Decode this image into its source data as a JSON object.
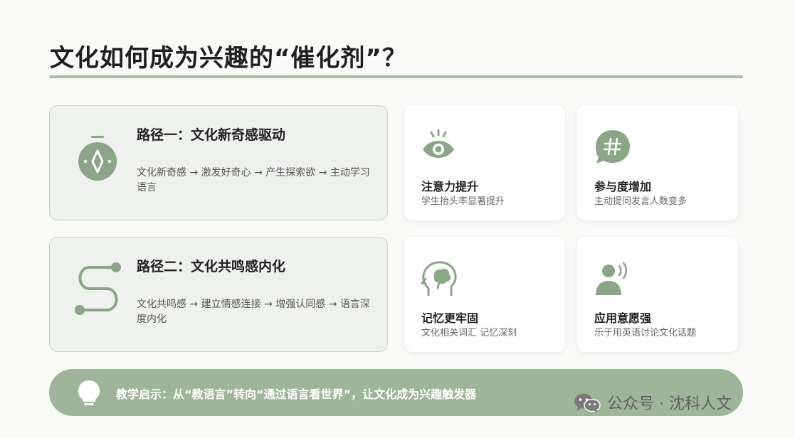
{
  "colors": {
    "accent_green": "#9fb59a",
    "icon_green": "#8aa686",
    "path_card_bg": "#eff1ee",
    "title_rule": "#a9bfa3"
  },
  "title": "文化如何成为兴趣的“催化剂”？",
  "paths": [
    {
      "icon": "compass-icon",
      "title": "路径一：文化新奇感驱动",
      "desc": "文化新奇感 → 激发好奇心 → 产生探索欲 → 主动学习语言"
    },
    {
      "icon": "winding-path-icon",
      "title": "路径二：文化共鸣感内化",
      "desc": "文化共鸣感 → 建立情感连接 → 增强认同感 → 语言深度内化"
    }
  ],
  "stats": [
    {
      "icon": "eye-icon",
      "title": "注意力提升",
      "subtitle": "学生抬头率显著提升"
    },
    {
      "icon": "hashtag-bubble-icon",
      "title": "参与度增加",
      "subtitle": "主动提问发言人数变多"
    },
    {
      "icon": "brain-head-icon",
      "title": "记忆更牢固",
      "subtitle": "文化相关词汇 记忆深刻"
    },
    {
      "icon": "speaking-person-icon",
      "title": "应用意愿强",
      "subtitle": "乐于用英语讨论文化话题"
    }
  ],
  "banner": {
    "icon": "lightbulb-icon",
    "text": "教学启示：从“教语言”转向“通过语言看世界”，让文化成为兴趣触发器"
  },
  "watermark": {
    "icon": "wechat-icon",
    "text": "公众号 · 沈科人文"
  }
}
